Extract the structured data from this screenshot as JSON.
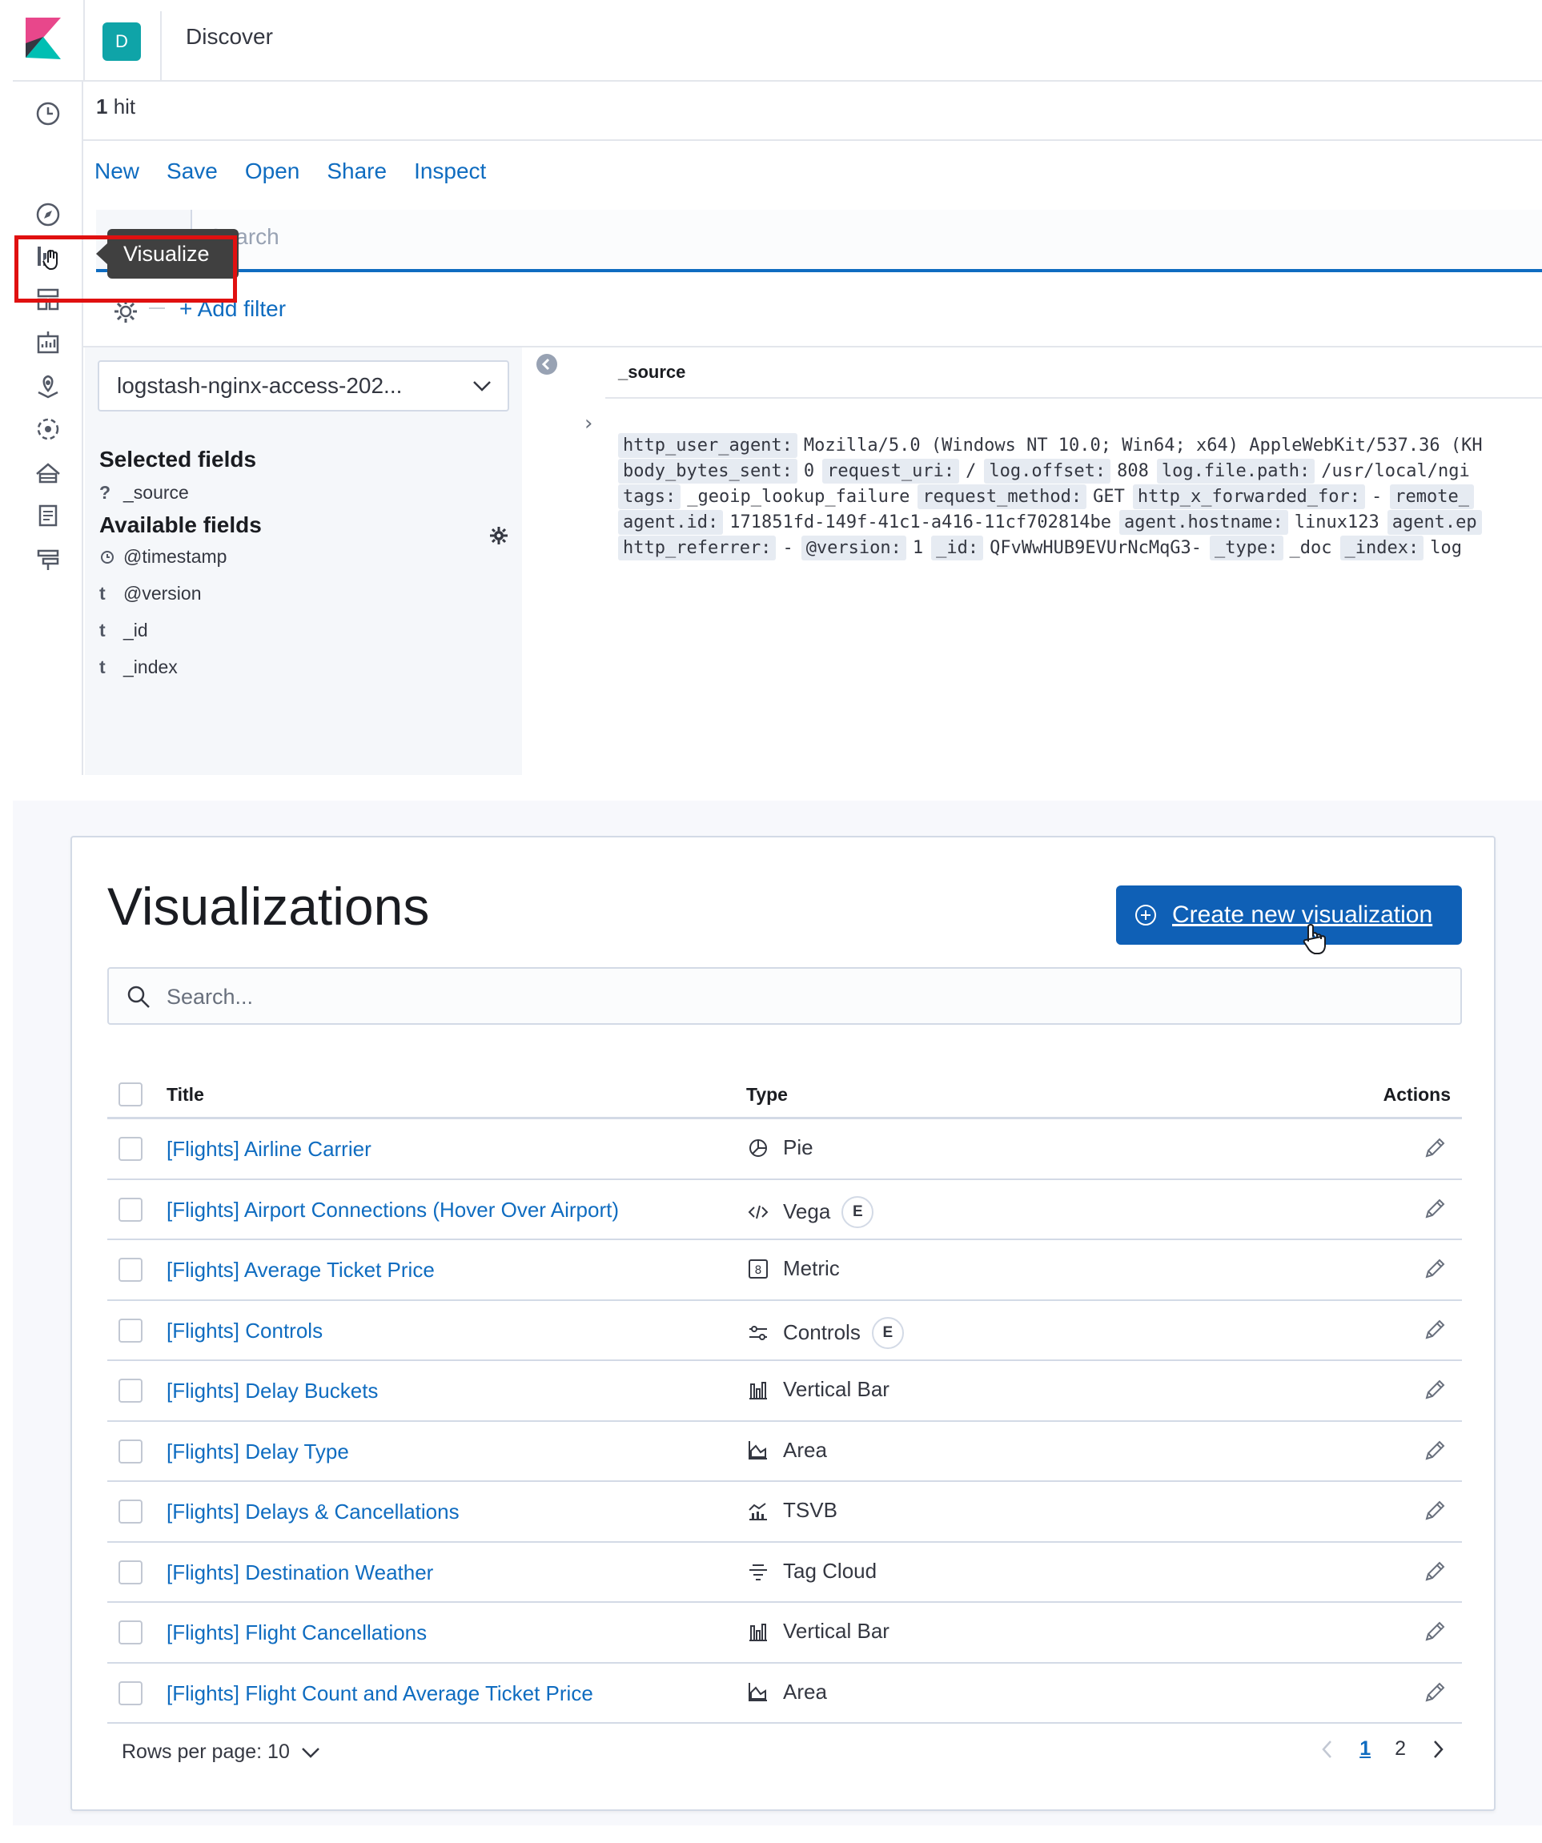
{
  "discover": {
    "app_title": "Discover",
    "space_initial": "D",
    "hits_count": "1",
    "hits_label": " hit",
    "menu": [
      "New",
      "Save",
      "Open",
      "Share",
      "Inspect"
    ],
    "search_placeholder": "Search",
    "add_filter": "+ Add filter",
    "tooltip": "Visualize",
    "index_pattern": "logstash-nginx-access-202...",
    "selected_fields_heading": "Selected fields",
    "selected_fields": [
      {
        "type": "?",
        "name": "_source"
      }
    ],
    "available_fields_heading": "Available fields",
    "available_fields": [
      {
        "type": "clock",
        "name": "@timestamp"
      },
      {
        "type": "t",
        "name": "@version"
      },
      {
        "type": "t",
        "name": "_id"
      },
      {
        "type": "t",
        "name": "_index"
      }
    ],
    "source_header": "_source",
    "source_rows": [
      [
        [
          "http_user_agent:",
          "Mozilla/5.0 (Windows NT 10.0; Win64; x64) AppleWebKit/537.36 (KH"
        ]
      ],
      [
        [
          "body_bytes_sent:",
          "0"
        ],
        [
          "request_uri:",
          "/"
        ],
        [
          "log.offset:",
          "808"
        ],
        [
          "log.file.path:",
          "/usr/local/ngi"
        ]
      ],
      [
        [
          "tags:",
          "_geoip_lookup_failure"
        ],
        [
          "request_method:",
          "GET"
        ],
        [
          "http_x_forwarded_for:",
          "-"
        ],
        [
          "remote_",
          ""
        ]
      ],
      [
        [
          "agent.id:",
          "171851fd-149f-41c1-a416-11cf702814be"
        ],
        [
          "agent.hostname:",
          "linux123"
        ],
        [
          "agent.ep",
          ""
        ]
      ],
      [
        [
          "http_referrer:",
          "-"
        ],
        [
          "@version:",
          "1"
        ],
        [
          "_id:",
          "QFvWwHUB9EVUrNcMqG3-"
        ],
        [
          "_type:",
          "_doc"
        ],
        [
          "_index:",
          "log"
        ]
      ]
    ]
  },
  "visualizations": {
    "title": "Visualizations",
    "create_button": "Create new visualization",
    "search_placeholder": "Search...",
    "columns": {
      "title": "Title",
      "type": "Type",
      "actions": "Actions"
    },
    "experimental_badge": "E",
    "rows": [
      {
        "title": "[Flights] Airline Carrier",
        "type": "Pie",
        "icon": "pie-icon",
        "experimental": false
      },
      {
        "title": "[Flights] Airport Connections (Hover Over Airport)",
        "type": "Vega",
        "icon": "code-icon",
        "experimental": true
      },
      {
        "title": "[Flights] Average Ticket Price",
        "type": "Metric",
        "icon": "metric-icon",
        "experimental": false
      },
      {
        "title": "[Flights] Controls",
        "type": "Controls",
        "icon": "controls-icon",
        "experimental": true
      },
      {
        "title": "[Flights] Delay Buckets",
        "type": "Vertical Bar",
        "icon": "bar-chart-icon",
        "experimental": false
      },
      {
        "title": "[Flights] Delay Type",
        "type": "Area",
        "icon": "area-chart-icon",
        "experimental": false
      },
      {
        "title": "[Flights] Delays & Cancellations",
        "type": "TSVB",
        "icon": "tsvb-icon",
        "experimental": false
      },
      {
        "title": "[Flights] Destination Weather",
        "type": "Tag Cloud",
        "icon": "tag-cloud-icon",
        "experimental": false
      },
      {
        "title": "[Flights] Flight Cancellations",
        "type": "Vertical Bar",
        "icon": "bar-chart-icon",
        "experimental": false
      },
      {
        "title": "[Flights] Flight Count and Average Ticket Price",
        "type": "Area",
        "icon": "area-chart-icon",
        "experimental": false
      }
    ],
    "rows_per_page": "Rows per page: 10",
    "pages": [
      "1",
      "2"
    ],
    "current_page": "1"
  }
}
